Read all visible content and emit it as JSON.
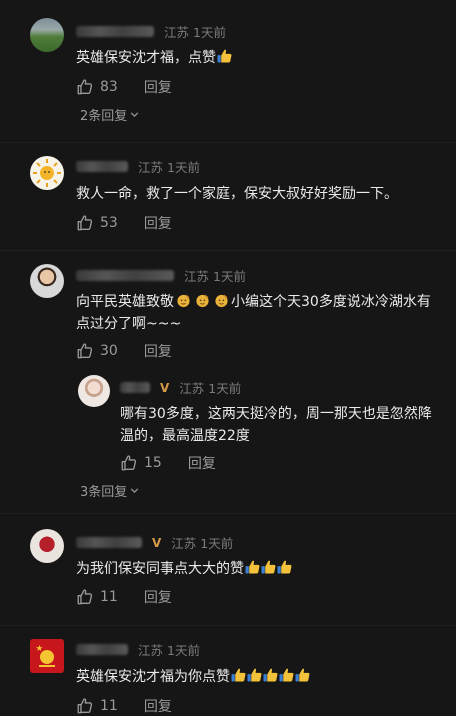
{
  "comments": [
    {
      "location": "江苏",
      "time": "1天前",
      "text": "英雄保安沈才福，点赞",
      "likes": "83",
      "reply_label": "回复",
      "replies_label": "2条回复"
    },
    {
      "location": "江苏",
      "time": "1天前",
      "text": "救人一命，救了一个家庭，保安大叔好好奖励一下。",
      "likes": "53",
      "reply_label": "回复"
    },
    {
      "location": "江苏",
      "time": "1天前",
      "text_line1_a": "向平民英雄致敬",
      "text_line1_b": "小编这个天30多度说冰冷湖水有",
      "text_line2": "点过分了啊~~~",
      "likes": "30",
      "reply_label": "回复",
      "reply": {
        "location": "江苏",
        "time": "1天前",
        "text_line1": "哪有30多度，这两天挺冷的，周一那天也是忽然降",
        "text_line2": "温的，最高温度22度",
        "likes": "15",
        "reply_label": "回复"
      },
      "replies_label": "3条回复"
    },
    {
      "location": "江苏",
      "time": "1天前",
      "text": "为我们保安同事点大大的赞",
      "likes": "11",
      "reply_label": "回复"
    },
    {
      "location": "江苏",
      "time": "1天前",
      "text": "英雄保安沈才福为你点赞",
      "likes": "11",
      "reply_label": "回复"
    }
  ],
  "icons": {
    "like": "thumbs-up-outline-icon",
    "chevron": "chevron-down-icon",
    "thumb_emoji": "thumbs-up-emoji",
    "salute_emoji": "salute-emoji"
  },
  "colors": {
    "background": "#161616",
    "text": "#eaeaea",
    "muted": "#7b7b7b",
    "emoji_gold": "#f4c23a"
  }
}
